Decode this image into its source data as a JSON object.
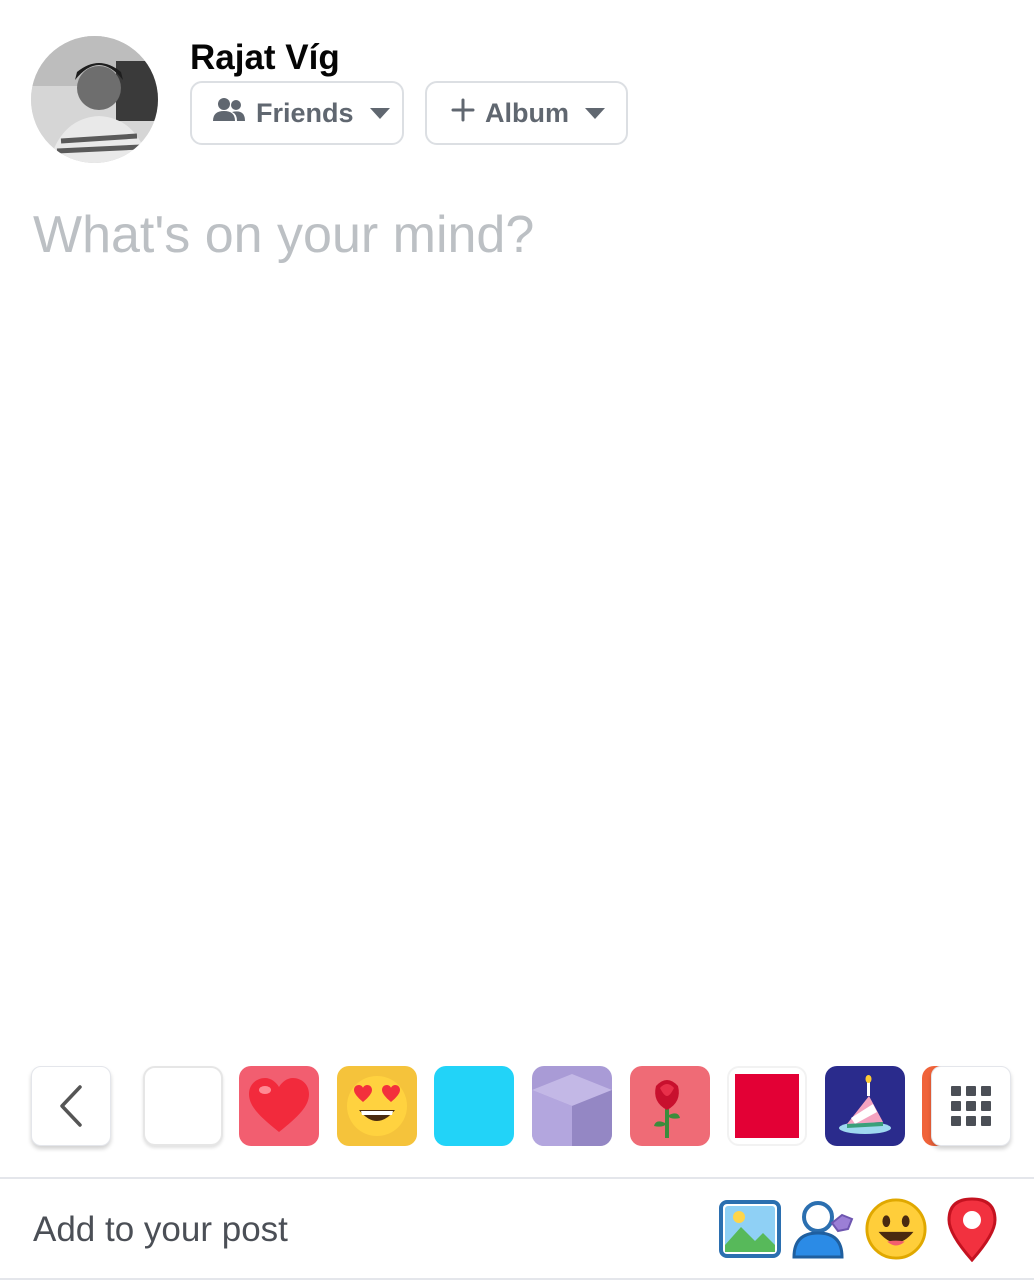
{
  "header": {
    "user_name": "Rajat Víg",
    "audience_label": "Friends",
    "album_label": "Album"
  },
  "composer": {
    "placeholder": "What's on your mind?",
    "value": ""
  },
  "backgrounds": {
    "items": [
      {
        "name": "plain-white",
        "color": "#ffffff"
      },
      {
        "name": "heart",
        "color": "#f25e70"
      },
      {
        "name": "heart-eyes-emoji",
        "color": "#f5c33b"
      },
      {
        "name": "cyan",
        "color": "#22d3f8"
      },
      {
        "name": "lavender-cubes",
        "color": "#a99bd6"
      },
      {
        "name": "rose",
        "color": "#ef6b76"
      },
      {
        "name": "red",
        "color": "#e30035"
      },
      {
        "name": "birthday-cake",
        "color": "#2a2b8c"
      },
      {
        "name": "orange-partial",
        "color": "#f0633a"
      }
    ]
  },
  "footer": {
    "add_to_post_label": "Add to your post",
    "tools": [
      "photo-icon",
      "tag-people-icon",
      "feeling-emoji-icon",
      "location-pin-icon"
    ]
  },
  "colors": {
    "secondary_text": "#606770",
    "placeholder": "#bcc0c4",
    "border": "#dcdfe3"
  }
}
